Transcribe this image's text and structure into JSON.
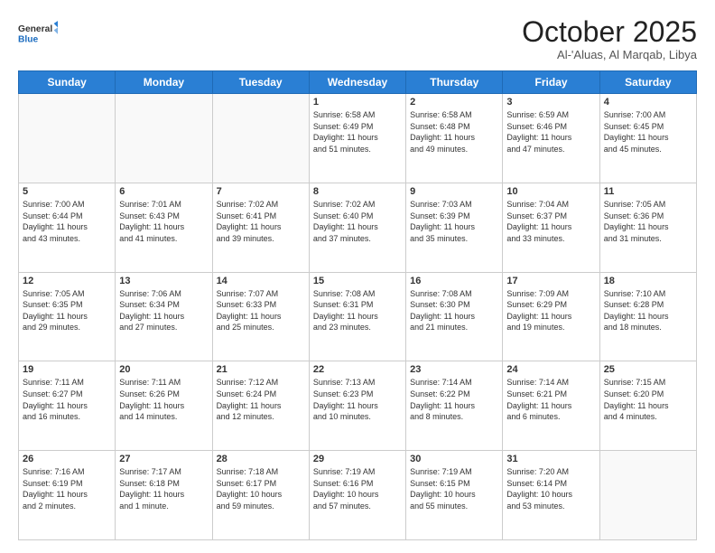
{
  "logo": {
    "general": "General",
    "blue": "Blue"
  },
  "title": "October 2025",
  "location": "Al-'Aluas, Al Marqab, Libya",
  "days_header": [
    "Sunday",
    "Monday",
    "Tuesday",
    "Wednesday",
    "Thursday",
    "Friday",
    "Saturday"
  ],
  "weeks": [
    [
      {
        "num": "",
        "info": ""
      },
      {
        "num": "",
        "info": ""
      },
      {
        "num": "",
        "info": ""
      },
      {
        "num": "1",
        "info": "Sunrise: 6:58 AM\nSunset: 6:49 PM\nDaylight: 11 hours\nand 51 minutes."
      },
      {
        "num": "2",
        "info": "Sunrise: 6:58 AM\nSunset: 6:48 PM\nDaylight: 11 hours\nand 49 minutes."
      },
      {
        "num": "3",
        "info": "Sunrise: 6:59 AM\nSunset: 6:46 PM\nDaylight: 11 hours\nand 47 minutes."
      },
      {
        "num": "4",
        "info": "Sunrise: 7:00 AM\nSunset: 6:45 PM\nDaylight: 11 hours\nand 45 minutes."
      }
    ],
    [
      {
        "num": "5",
        "info": "Sunrise: 7:00 AM\nSunset: 6:44 PM\nDaylight: 11 hours\nand 43 minutes."
      },
      {
        "num": "6",
        "info": "Sunrise: 7:01 AM\nSunset: 6:43 PM\nDaylight: 11 hours\nand 41 minutes."
      },
      {
        "num": "7",
        "info": "Sunrise: 7:02 AM\nSunset: 6:41 PM\nDaylight: 11 hours\nand 39 minutes."
      },
      {
        "num": "8",
        "info": "Sunrise: 7:02 AM\nSunset: 6:40 PM\nDaylight: 11 hours\nand 37 minutes."
      },
      {
        "num": "9",
        "info": "Sunrise: 7:03 AM\nSunset: 6:39 PM\nDaylight: 11 hours\nand 35 minutes."
      },
      {
        "num": "10",
        "info": "Sunrise: 7:04 AM\nSunset: 6:37 PM\nDaylight: 11 hours\nand 33 minutes."
      },
      {
        "num": "11",
        "info": "Sunrise: 7:05 AM\nSunset: 6:36 PM\nDaylight: 11 hours\nand 31 minutes."
      }
    ],
    [
      {
        "num": "12",
        "info": "Sunrise: 7:05 AM\nSunset: 6:35 PM\nDaylight: 11 hours\nand 29 minutes."
      },
      {
        "num": "13",
        "info": "Sunrise: 7:06 AM\nSunset: 6:34 PM\nDaylight: 11 hours\nand 27 minutes."
      },
      {
        "num": "14",
        "info": "Sunrise: 7:07 AM\nSunset: 6:33 PM\nDaylight: 11 hours\nand 25 minutes."
      },
      {
        "num": "15",
        "info": "Sunrise: 7:08 AM\nSunset: 6:31 PM\nDaylight: 11 hours\nand 23 minutes."
      },
      {
        "num": "16",
        "info": "Sunrise: 7:08 AM\nSunset: 6:30 PM\nDaylight: 11 hours\nand 21 minutes."
      },
      {
        "num": "17",
        "info": "Sunrise: 7:09 AM\nSunset: 6:29 PM\nDaylight: 11 hours\nand 19 minutes."
      },
      {
        "num": "18",
        "info": "Sunrise: 7:10 AM\nSunset: 6:28 PM\nDaylight: 11 hours\nand 18 minutes."
      }
    ],
    [
      {
        "num": "19",
        "info": "Sunrise: 7:11 AM\nSunset: 6:27 PM\nDaylight: 11 hours\nand 16 minutes."
      },
      {
        "num": "20",
        "info": "Sunrise: 7:11 AM\nSunset: 6:26 PM\nDaylight: 11 hours\nand 14 minutes."
      },
      {
        "num": "21",
        "info": "Sunrise: 7:12 AM\nSunset: 6:24 PM\nDaylight: 11 hours\nand 12 minutes."
      },
      {
        "num": "22",
        "info": "Sunrise: 7:13 AM\nSunset: 6:23 PM\nDaylight: 11 hours\nand 10 minutes."
      },
      {
        "num": "23",
        "info": "Sunrise: 7:14 AM\nSunset: 6:22 PM\nDaylight: 11 hours\nand 8 minutes."
      },
      {
        "num": "24",
        "info": "Sunrise: 7:14 AM\nSunset: 6:21 PM\nDaylight: 11 hours\nand 6 minutes."
      },
      {
        "num": "25",
        "info": "Sunrise: 7:15 AM\nSunset: 6:20 PM\nDaylight: 11 hours\nand 4 minutes."
      }
    ],
    [
      {
        "num": "26",
        "info": "Sunrise: 7:16 AM\nSunset: 6:19 PM\nDaylight: 11 hours\nand 2 minutes."
      },
      {
        "num": "27",
        "info": "Sunrise: 7:17 AM\nSunset: 6:18 PM\nDaylight: 11 hours\nand 1 minute."
      },
      {
        "num": "28",
        "info": "Sunrise: 7:18 AM\nSunset: 6:17 PM\nDaylight: 10 hours\nand 59 minutes."
      },
      {
        "num": "29",
        "info": "Sunrise: 7:19 AM\nSunset: 6:16 PM\nDaylight: 10 hours\nand 57 minutes."
      },
      {
        "num": "30",
        "info": "Sunrise: 7:19 AM\nSunset: 6:15 PM\nDaylight: 10 hours\nand 55 minutes."
      },
      {
        "num": "31",
        "info": "Sunrise: 7:20 AM\nSunset: 6:14 PM\nDaylight: 10 hours\nand 53 minutes."
      },
      {
        "num": "",
        "info": ""
      }
    ]
  ]
}
